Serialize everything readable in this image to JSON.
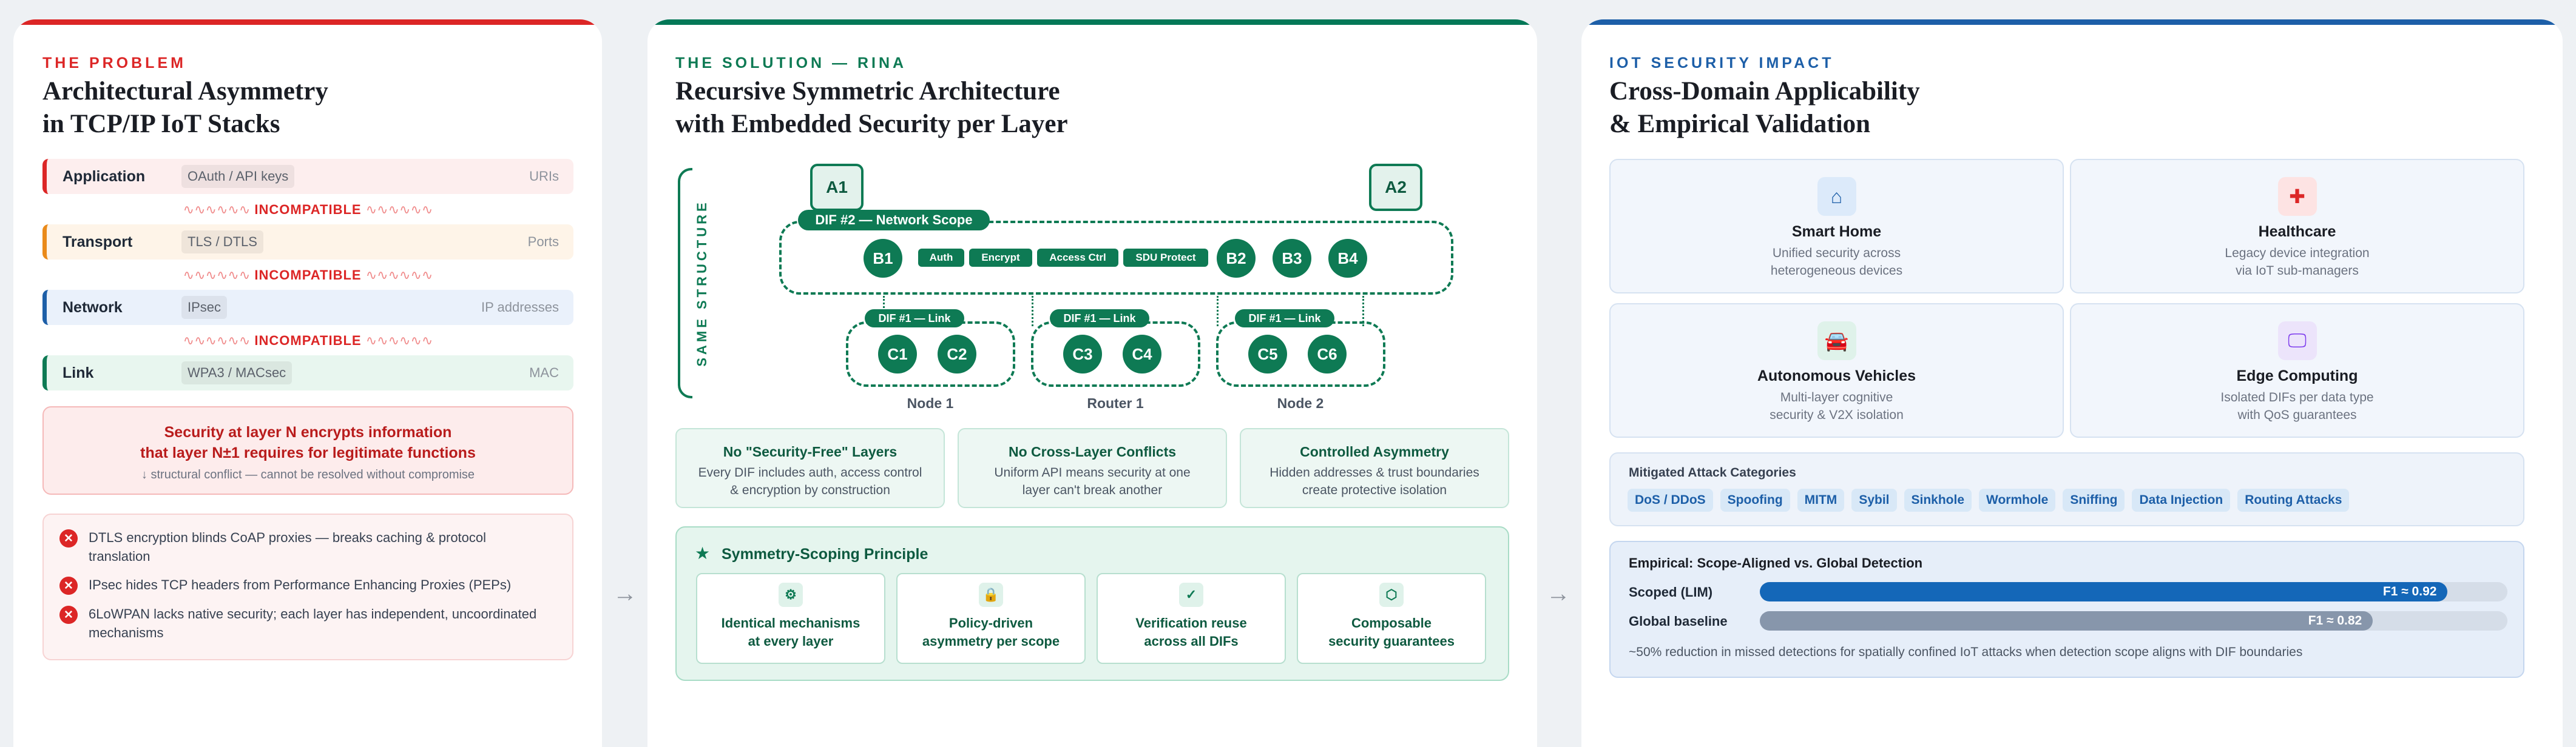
{
  "problem": {
    "eyebrow": "THE PROBLEM",
    "title_line1": "Architectural Asymmetry",
    "title_line2": "in TCP/IP IoT Stacks",
    "layers": [
      {
        "name": "Application",
        "tag": "OAuth / API keys",
        "right": "URIs",
        "bg": "#fdeeee",
        "border": "#dc2626"
      },
      {
        "name": "Transport",
        "tag": "TLS / DTLS",
        "right": "Ports",
        "bg": "#fef4e8",
        "border": "#ea8a1a"
      },
      {
        "name": "Network",
        "tag": "IPsec",
        "right": "IP addresses",
        "bg": "#eaf1fb",
        "border": "#1d5fa8"
      },
      {
        "name": "Link",
        "tag": "WPA3 / MACsec",
        "right": "MAC",
        "bg": "#e8f6ef",
        "border": "#0e7a54"
      }
    ],
    "incompatible_label": "INCOMPATIBLE",
    "wave": "∿∿∿∿∿∿",
    "conflict_line1": "Security at layer N encrypts information",
    "conflict_line2": "that layer N±1 requires for legitimate functions",
    "conflict_note": "↓ structural conflict — cannot be resolved without compromise",
    "issues": [
      "DTLS encryption blinds CoAP proxies — breaks caching & protocol translation",
      "IPsec hides TCP headers from Performance Enhancing Proxies (PEPs)",
      "6LoWPAN lacks native security; each layer has independent, uncoordinated mechanisms"
    ],
    "issue_icon": "✕"
  },
  "arrow": "→",
  "solution": {
    "eyebrow": "THE SOLUTION — RINA",
    "title_line1": "Recursive Symmetric Architecture",
    "title_line2": "with Embedded Security per Layer",
    "side_label": "SAME STRUCTURE",
    "apps": [
      "A1",
      "A2"
    ],
    "dif2_label": "DIF #2 — Network Scope",
    "dif2_nodes_left": [
      "B1"
    ],
    "dif2_chips": [
      "Auth",
      "Encrypt",
      "Access Ctrl",
      "SDU Protect"
    ],
    "dif2_nodes_right": [
      "B2",
      "B3",
      "B4"
    ],
    "dif1_label": "DIF #1 — Link",
    "dif1_groups": [
      {
        "nodes": [
          "C1",
          "C2"
        ],
        "caption": "Node 1"
      },
      {
        "nodes": [
          "C3",
          "C4"
        ],
        "caption": "Router 1"
      },
      {
        "nodes": [
          "C5",
          "C6"
        ],
        "caption": "Node 2"
      }
    ],
    "properties": [
      {
        "title": "No \"Security-Free\" Layers",
        "line1": "Every DIF includes auth, access control",
        "line2": "& encryption by construction"
      },
      {
        "title": "No Cross-Layer Conflicts",
        "line1": "Uniform API means security at one",
        "line2": "layer can't break another"
      },
      {
        "title": "Controlled Asymmetry",
        "line1": "Hidden addresses & trust boundaries",
        "line2": "create protective isolation"
      }
    ],
    "principle_star": "★",
    "principle_title": "Symmetry-Scoping Principle",
    "principles": [
      {
        "icon": "gear-icon",
        "glyph": "⚙",
        "line1": "Identical mechanisms",
        "line2": "at every layer"
      },
      {
        "icon": "lock-icon",
        "glyph": "🔒",
        "line1": "Policy-driven",
        "line2": "asymmetry per scope"
      },
      {
        "icon": "check-icon",
        "glyph": "✓",
        "line1": "Verification reuse",
        "line2": "across all DIFs"
      },
      {
        "icon": "shield-icon",
        "glyph": "⬡",
        "line1": "Composable",
        "line2": "security guarantees"
      }
    ]
  },
  "impact": {
    "eyebrow": "IOT SECURITY IMPACT",
    "title_line1": "Cross-Domain Applicability",
    "title_line2": "& Empirical Validation",
    "domains": [
      {
        "icon": "home-icon",
        "glyph": "⌂",
        "title": "Smart Home",
        "line1": "Unified security across",
        "line2": "heterogeneous devices",
        "bg": "#dceafa",
        "fg": "#1d5fa8"
      },
      {
        "icon": "medical-cross-icon",
        "glyph": "✚",
        "title": "Healthcare",
        "line1": "Legacy device integration",
        "line2": "via IoT sub-managers",
        "bg": "#fde3e3",
        "fg": "#dc2626"
      },
      {
        "icon": "car-icon",
        "glyph": "🚘",
        "title": "Autonomous Vehicles",
        "line1": "Multi-layer cognitive",
        "line2": "security & V2X isolation",
        "bg": "#dff2ea",
        "fg": "#0e7a54"
      },
      {
        "icon": "monitor-icon",
        "glyph": "🖵",
        "title": "Edge Computing",
        "line1": "Isolated DIFs per data type",
        "line2": "with QoS guarantees",
        "bg": "#ece4fb",
        "fg": "#7c3aed"
      }
    ],
    "attacks_title": "Mitigated Attack Categories",
    "attacks": [
      "DoS / DDoS",
      "Spoofing",
      "MITM",
      "Sybil",
      "Sinkhole",
      "Wormhole",
      "Sniffing",
      "Data Injection",
      "Routing Attacks"
    ],
    "empirical_title": "Empirical: Scope-Aligned vs. Global Detection",
    "bars": [
      {
        "label": "Scoped (LIM)",
        "value_label": "F1 ≈ 0.92",
        "value": 0.92,
        "color": "#1467b8"
      },
      {
        "label": "Global baseline",
        "value_label": "F1 ≈ 0.82",
        "value": 0.82,
        "color": "#8796ab"
      }
    ],
    "empirical_note": "~50% reduction in missed detections for spatially confined IoT attacks when detection scope aligns with DIF boundaries"
  }
}
